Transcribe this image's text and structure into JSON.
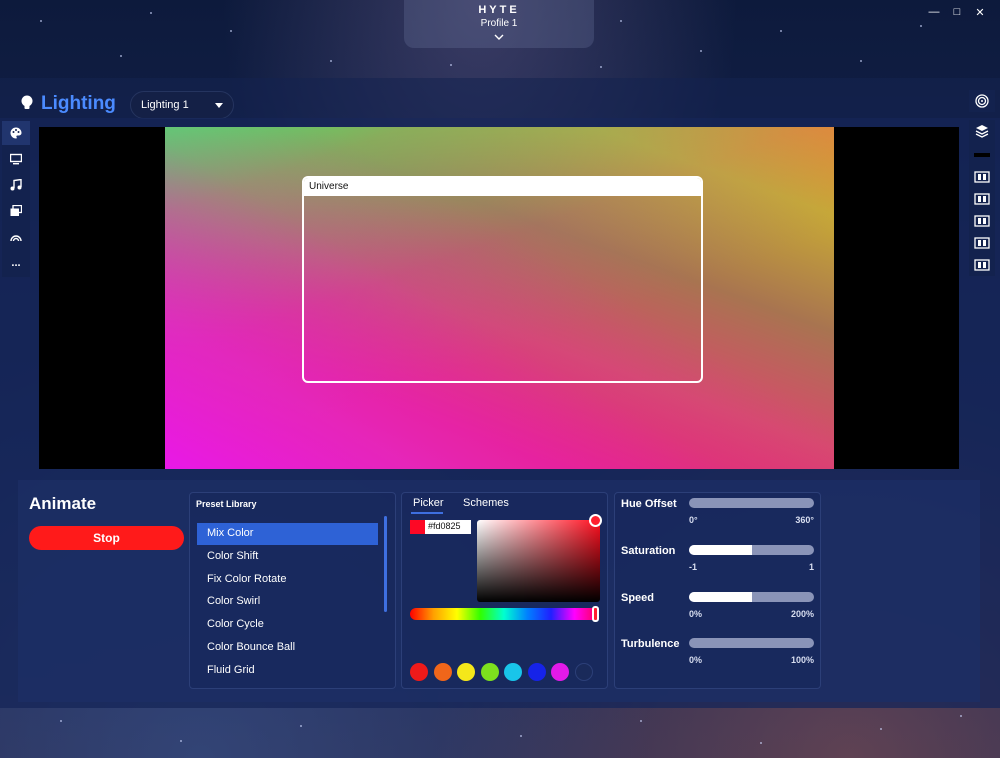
{
  "window": {
    "logo": "HYTE",
    "profile": "Profile 1",
    "controls": [
      "—",
      "□",
      "✕"
    ]
  },
  "header": {
    "title": "Lighting",
    "dropdown_value": "Lighting 1"
  },
  "left_sidebar": {
    "items": [
      "palette-icon",
      "monitor-icon",
      "music-icon",
      "layers-copy-icon",
      "rainbow-icon",
      "more-icon"
    ],
    "more_label": "..."
  },
  "right_sidebar": {
    "items": [
      "target-icon",
      "layers-icon",
      "bar-icon",
      "device-icon",
      "device-icon",
      "device-icon",
      "device-icon",
      "device-icon"
    ]
  },
  "preview": {
    "zone_label": "Universe"
  },
  "animate": {
    "title": "Animate",
    "stop_label": "Stop"
  },
  "preset_library": {
    "title": "Preset Library",
    "items": [
      "Mix Color",
      "Color Shift",
      "Fix Color Rotate",
      "Color Swirl",
      "Color Cycle",
      "Color Bounce Ball",
      "Fluid Grid"
    ],
    "selected_index": 0
  },
  "color": {
    "tabs": [
      "Picker",
      "Schemes"
    ],
    "active_tab": "Picker",
    "hex": "#fd0825",
    "swatches": [
      "#ee1a1a",
      "#f0661a",
      "#f5e71a",
      "#7de01e",
      "#19c5ea",
      "#1623e8",
      "#e21ae8",
      "#1a2a5a"
    ]
  },
  "sliders": [
    {
      "label": "Hue Offset",
      "min": "0°",
      "max": "360°",
      "fraction": 0.0
    },
    {
      "label": "Saturation",
      "min": "-1",
      "max": "1",
      "fraction": 0.5
    },
    {
      "label": "Speed",
      "min": "0%",
      "max": "200%",
      "fraction": 0.5
    },
    {
      "label": "Turbulence",
      "min": "0%",
      "max": "100%",
      "fraction": 0.0
    }
  ]
}
